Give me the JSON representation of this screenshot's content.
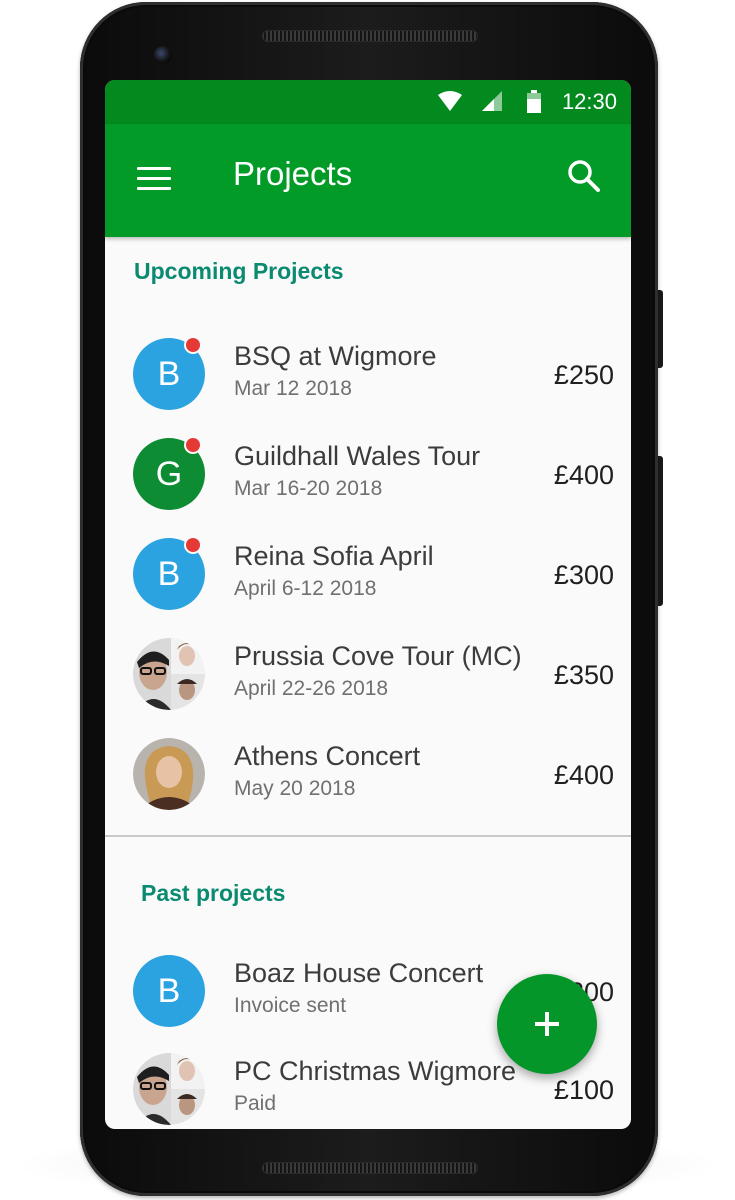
{
  "status_bar": {
    "time": "12:30",
    "icons": [
      "wifi-icon",
      "signal-icon",
      "battery-icon"
    ]
  },
  "app_bar": {
    "title": "Projects",
    "menu_icon": "hamburger-menu-icon",
    "search_icon": "search-icon"
  },
  "upcoming": {
    "header": "Upcoming Projects",
    "items": [
      {
        "avatar_letter": "B",
        "avatar_color": "#2aa3e0",
        "has_unread_dot": true,
        "name": "BSQ at Wigmore",
        "date": "Mar 12 2018",
        "amount": "£250"
      },
      {
        "avatar_letter": "G",
        "avatar_color": "#0e8c33",
        "has_unread_dot": true,
        "name": "Guildhall Wales Tour",
        "date": "Mar 16-20 2018",
        "amount": "£400"
      },
      {
        "avatar_letter": "B",
        "avatar_color": "#2aa3e0",
        "has_unread_dot": true,
        "name": "Reina Sofia April",
        "date": "April 6-12 2018",
        "amount": "£300"
      },
      {
        "avatar_type": "group-photo",
        "name": "Prussia Cove Tour (MC)",
        "date": "April 22-26 2018",
        "amount": "£350"
      },
      {
        "avatar_type": "person-photo",
        "name": "Athens Concert",
        "date": "May 20 2018",
        "amount": "£400"
      }
    ]
  },
  "past": {
    "header": "Past projects",
    "items": [
      {
        "avatar_letter": "B",
        "avatar_color": "#2aa3e0",
        "name": "Boaz House Concert",
        "status": "Invoice sent",
        "amount": "£200"
      },
      {
        "avatar_type": "group-photo",
        "name": "PC Christmas Wigmore",
        "status": "Paid",
        "amount": "£100"
      }
    ]
  },
  "fab": {
    "icon": "plus-icon",
    "color": "#05962a"
  },
  "colors": {
    "status_bar": "#028a1e",
    "app_bar": "#029b27",
    "section_header": "#0a8a70",
    "unread_dot": "#e53935"
  }
}
